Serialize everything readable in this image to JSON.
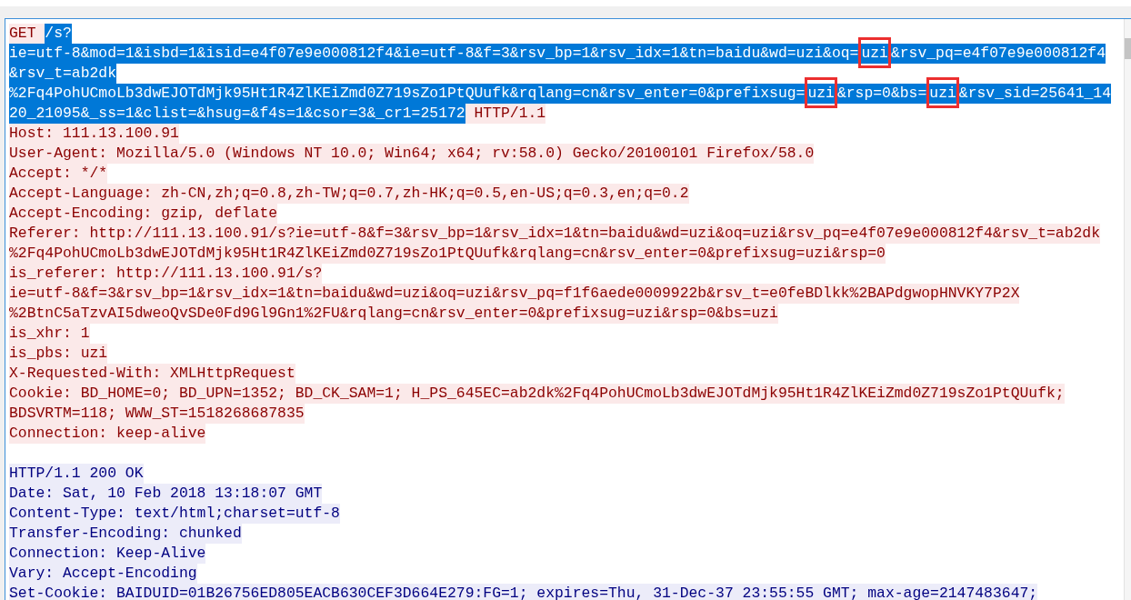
{
  "sections": [
    {
      "kind": "request",
      "lines": [
        {
          "segments": [
            {
              "text": "GET ",
              "selected": false,
              "marked": false
            },
            {
              "text": "/s?",
              "selected": true,
              "marked": false
            }
          ]
        },
        {
          "segments": [
            {
              "text": "ie=utf-8&mod=1&isbd=1&isid=e4f07e9e000812f4&ie=utf-8&f=3&rsv_bp=1&rsv_idx=1&tn=baidu&wd=uzi&oq=",
              "selected": true,
              "marked": false
            },
            {
              "text": "uzi",
              "selected": true,
              "marked": true
            },
            {
              "text": "&rsv_pq=e4f07e9e000812f4",
              "selected": true,
              "marked": false
            }
          ]
        },
        {
          "segments": [
            {
              "text": "&rsv_t=ab2dk",
              "selected": true,
              "marked": false
            }
          ]
        },
        {
          "segments": [
            {
              "text": "%2Fq4PohUCmoLb3dwEJOTdMjk95Ht1R4ZlKEiZmd0Z719sZo1PtQUufk&rqlang=cn&rsv_enter=0&prefixsug=",
              "selected": true,
              "marked": false
            },
            {
              "text": "uzi",
              "selected": true,
              "marked": true
            },
            {
              "text": "&rsp=0&bs=",
              "selected": true,
              "marked": false
            },
            {
              "text": "uzi",
              "selected": true,
              "marked": true
            },
            {
              "text": "&rsv_sid=25641_14",
              "selected": true,
              "marked": false
            }
          ]
        },
        {
          "segments": [
            {
              "text": "20_21095&_ss=1&clist=&hsug=&f4s=1&csor=3&_cr1=25172",
              "selected": true,
              "marked": false
            },
            {
              "text": " HTTP/1.1",
              "selected": false,
              "marked": false
            }
          ]
        },
        {
          "segments": [
            {
              "text": "Host: 111.13.100.91",
              "selected": false,
              "marked": false
            }
          ]
        },
        {
          "segments": [
            {
              "text": "User-Agent: Mozilla/5.0 (Windows NT 10.0; Win64; x64; rv:58.0) Gecko/20100101 Firefox/58.0",
              "selected": false,
              "marked": false
            }
          ]
        },
        {
          "segments": [
            {
              "text": "Accept: */*",
              "selected": false,
              "marked": false
            }
          ]
        },
        {
          "segments": [
            {
              "text": "Accept-Language: zh-CN,zh;q=0.8,zh-TW;q=0.7,zh-HK;q=0.5,en-US;q=0.3,en;q=0.2",
              "selected": false,
              "marked": false
            }
          ]
        },
        {
          "segments": [
            {
              "text": "Accept-Encoding: gzip, deflate",
              "selected": false,
              "marked": false
            }
          ]
        },
        {
          "segments": [
            {
              "text": "Referer: http://111.13.100.91/s?ie=utf-8&f=3&rsv_bp=1&rsv_idx=1&tn=baidu&wd=uzi&oq=uzi&rsv_pq=e4f07e9e000812f4&rsv_t=ab2dk",
              "selected": false,
              "marked": false
            }
          ]
        },
        {
          "segments": [
            {
              "text": "%2Fq4PohUCmoLb3dwEJOTdMjk95Ht1R4ZlKEiZmd0Z719sZo1PtQUufk&rqlang=cn&rsv_enter=0&prefixsug=uzi&rsp=0",
              "selected": false,
              "marked": false
            }
          ]
        },
        {
          "segments": [
            {
              "text": "is_referer: http://111.13.100.91/s?",
              "selected": false,
              "marked": false
            }
          ]
        },
        {
          "segments": [
            {
              "text": "ie=utf-8&f=3&rsv_bp=1&rsv_idx=1&tn=baidu&wd=uzi&oq=uzi&rsv_pq=f1f6aede0009922b&rsv_t=e0feBDlkk%2BAPdgwopHNVKY7P2X",
              "selected": false,
              "marked": false
            }
          ]
        },
        {
          "segments": [
            {
              "text": "%2BtnC5aTzvAI5dweoQvSDe0Fd9Gl9Gn1%2FU&rqlang=cn&rsv_enter=0&prefixsug=uzi&rsp=0&bs=uzi",
              "selected": false,
              "marked": false
            }
          ]
        },
        {
          "segments": [
            {
              "text": "is_xhr: 1",
              "selected": false,
              "marked": false
            }
          ]
        },
        {
          "segments": [
            {
              "text": "is_pbs: uzi",
              "selected": false,
              "marked": false
            }
          ]
        },
        {
          "segments": [
            {
              "text": "X-Requested-With: XMLHttpRequest",
              "selected": false,
              "marked": false
            }
          ]
        },
        {
          "segments": [
            {
              "text": "Cookie: BD_HOME=0; BD_UPN=1352; BD_CK_SAM=1; H_PS_645EC=ab2dk%2Fq4PohUCmoLb3dwEJOTdMjk95Ht1R4ZlKEiZmd0Z719sZo1PtQUufk;",
              "selected": false,
              "marked": false
            }
          ]
        },
        {
          "segments": [
            {
              "text": "BDSVRTM=118; WWW_ST=1518268687835",
              "selected": false,
              "marked": false
            }
          ]
        },
        {
          "segments": [
            {
              "text": "Connection: keep-alive",
              "selected": false,
              "marked": false
            }
          ]
        }
      ]
    },
    {
      "kind": "response",
      "lines": [
        {
          "segments": [
            {
              "text": "HTTP/1.1 200 OK",
              "selected": false,
              "marked": false
            }
          ]
        },
        {
          "segments": [
            {
              "text": "Date: Sat, 10 Feb 2018 13:18:07 GMT",
              "selected": false,
              "marked": false
            }
          ]
        },
        {
          "segments": [
            {
              "text": "Content-Type: text/html;charset=utf-8",
              "selected": false,
              "marked": false
            }
          ]
        },
        {
          "segments": [
            {
              "text": "Transfer-Encoding: chunked",
              "selected": false,
              "marked": false
            }
          ]
        },
        {
          "segments": [
            {
              "text": "Connection: Keep-Alive",
              "selected": false,
              "marked": false
            }
          ]
        },
        {
          "segments": [
            {
              "text": "Vary: Accept-Encoding",
              "selected": false,
              "marked": false
            }
          ]
        },
        {
          "segments": [
            {
              "text": "Set-Cookie: BAIDUID=01B26756ED805EACB630CEF3D664E279:FG=1; expires=Thu, 31-Dec-37 23:55:55 GMT; max-age=2147483647;",
              "selected": false,
              "marked": false
            }
          ]
        }
      ]
    }
  ]
}
